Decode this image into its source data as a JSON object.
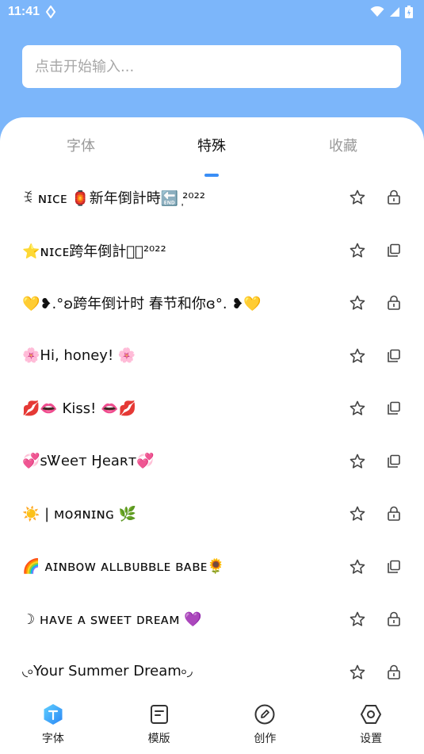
{
  "status_bar": {
    "time": "11:41"
  },
  "search": {
    "placeholder": "点击开始输入..."
  },
  "tabs": [
    {
      "label": "字体"
    },
    {
      "label": "特殊"
    },
    {
      "label": "收藏"
    }
  ],
  "items": [
    {
      "text": "ꉂ ɴɪᴄᴇ 🏮新年倒計時🔚 ᷂²⁰²²",
      "action": "lock"
    },
    {
      "text": "⭐ɴɪᴄᴇ跨年倒計時᷂²⁰²²",
      "action": "copy"
    },
    {
      "text": "💛❥.°ʚ跨年倒计时 春节和你ɞ°. ❥💛",
      "action": "lock"
    },
    {
      "text": "🌸Hi, honey! 🌸",
      "action": "copy"
    },
    {
      "text": "💋👄 Kiss! 👄💋",
      "action": "copy"
    },
    {
      "text": "💞ꜱᏔeeт Ӈeaʀт💞",
      "action": "copy"
    },
    {
      "text": "☀️ | ᴍᴏяɴɪɴɢ 🌿",
      "action": "lock"
    },
    {
      "text": "🌈 ᴀɪɴʙᴏᴡ ᴀʟʟʙᴜʙʙʟᴇ ʙᴀʙᴇ🌻",
      "action": "copy"
    },
    {
      "text": "☽ ʜᴀᴠᴇ ᴀ ꜱᴡᴇᴇᴛ ᴅʀᴇᴀᴍ 💜",
      "action": "lock"
    },
    {
      "text": "◟৹Your Summer Dream৹◞",
      "action": "lock"
    }
  ],
  "bottom_nav": [
    {
      "label": "字体",
      "icon": "font-app-icon",
      "active": true
    },
    {
      "label": "模版",
      "icon": "template-icon"
    },
    {
      "label": "创作",
      "icon": "create-pencil-icon"
    },
    {
      "label": "设置",
      "icon": "settings-hexagon-icon"
    }
  ],
  "colors": {
    "header": "#7cb6fa",
    "accent": "#3a8ef6"
  }
}
